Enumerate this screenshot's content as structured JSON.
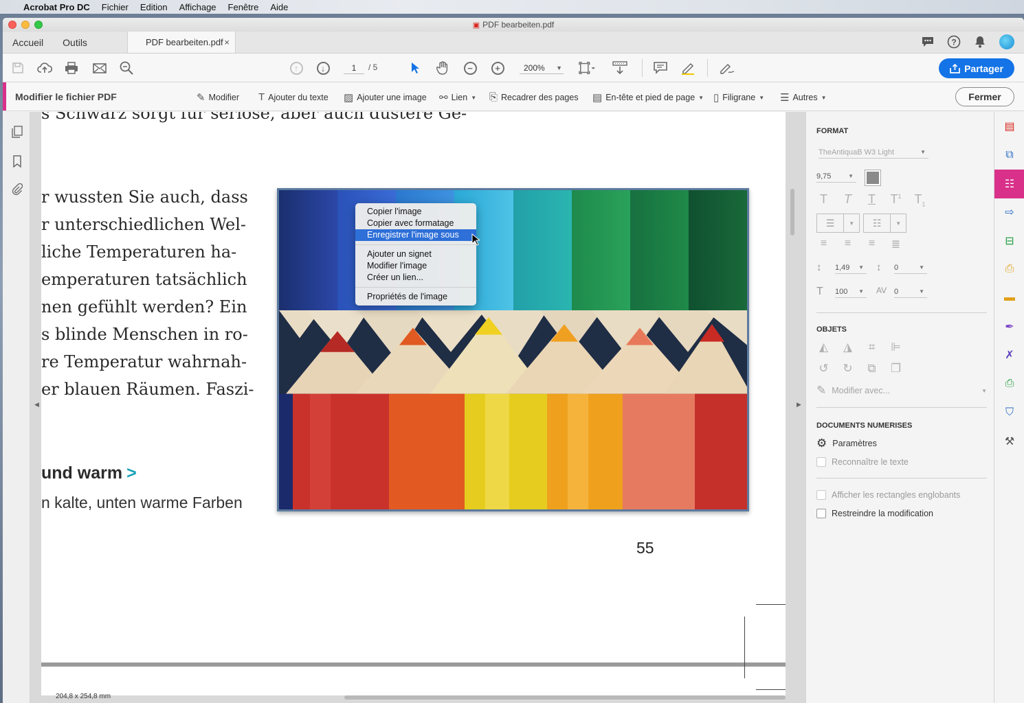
{
  "menubar": {
    "items": [
      "Acrobat Pro DC",
      "Fichier",
      "Edition",
      "Affichage",
      "Fenêtre",
      "Aide"
    ]
  },
  "window": {
    "title": "PDF bearbeiten.pdf"
  },
  "tabs": {
    "home": "Accueil",
    "tools": "Outils",
    "document": "PDF bearbeiten.pdf",
    "close": "×"
  },
  "toolbar": {
    "page_current": "1",
    "page_total": "/ 5",
    "zoom": "200%",
    "share": "Partager"
  },
  "editbar": {
    "title": "Modifier le fichier PDF",
    "items": [
      "Modifier",
      "Ajouter du texte",
      "Ajouter une image",
      "Lien",
      "Recadrer des pages",
      "En-tête et pied de page",
      "Filigrane",
      "Autres"
    ],
    "close": "Fermer"
  },
  "document": {
    "lines": [
      "s Schwarz sorgt für seriöse, aber auch düstere Ge-",
      "r wussten Sie auch, dass",
      "r unterschiedlichen Wel-",
      "liche Temperaturen ha-",
      "emperaturen tatsächlich",
      "nen gefühlt werden? Ein",
      "s blinde Menschen in ro-",
      "re Temperatur wahrnah-",
      "er blauen Räumen. Faszi-"
    ],
    "heading": "und warm",
    "heading_arrow": ">",
    "subline": "n kalte, unten warme Farben",
    "page_number": "55",
    "dimensions": "204,8 x 254,8 mm"
  },
  "context_menu": {
    "group1": [
      "Copier l'image",
      "Copier avec formatage",
      "Enregistrer l'image sous"
    ],
    "group2": [
      "Ajouter un signet",
      "Modifier l'image",
      "Créer un lien..."
    ],
    "group3": [
      "Propriétés de l'image"
    ],
    "selected": "Enregistrer l'image sous"
  },
  "panel": {
    "format_header": "FORMAT",
    "font": "TheAntiquaB W3 Light",
    "font_size": "9,75",
    "line_spacing": "1,49",
    "para_spacing": "0",
    "scale": "100",
    "tracking": "0",
    "objects_header": "OBJETS",
    "modify_with": "Modifier avec...",
    "scanned_header": "DOCUMENTS NUMERISES",
    "settings": "Paramètres",
    "recognize_text": "Reconnaître le texte",
    "show_bounding": "Afficher les rectangles englobants",
    "restrict_edit": "Restreindre la modification"
  },
  "colors": {
    "accent": "#d9308a",
    "primary": "#1473e6",
    "menu_selected": "#2e6fd8"
  }
}
